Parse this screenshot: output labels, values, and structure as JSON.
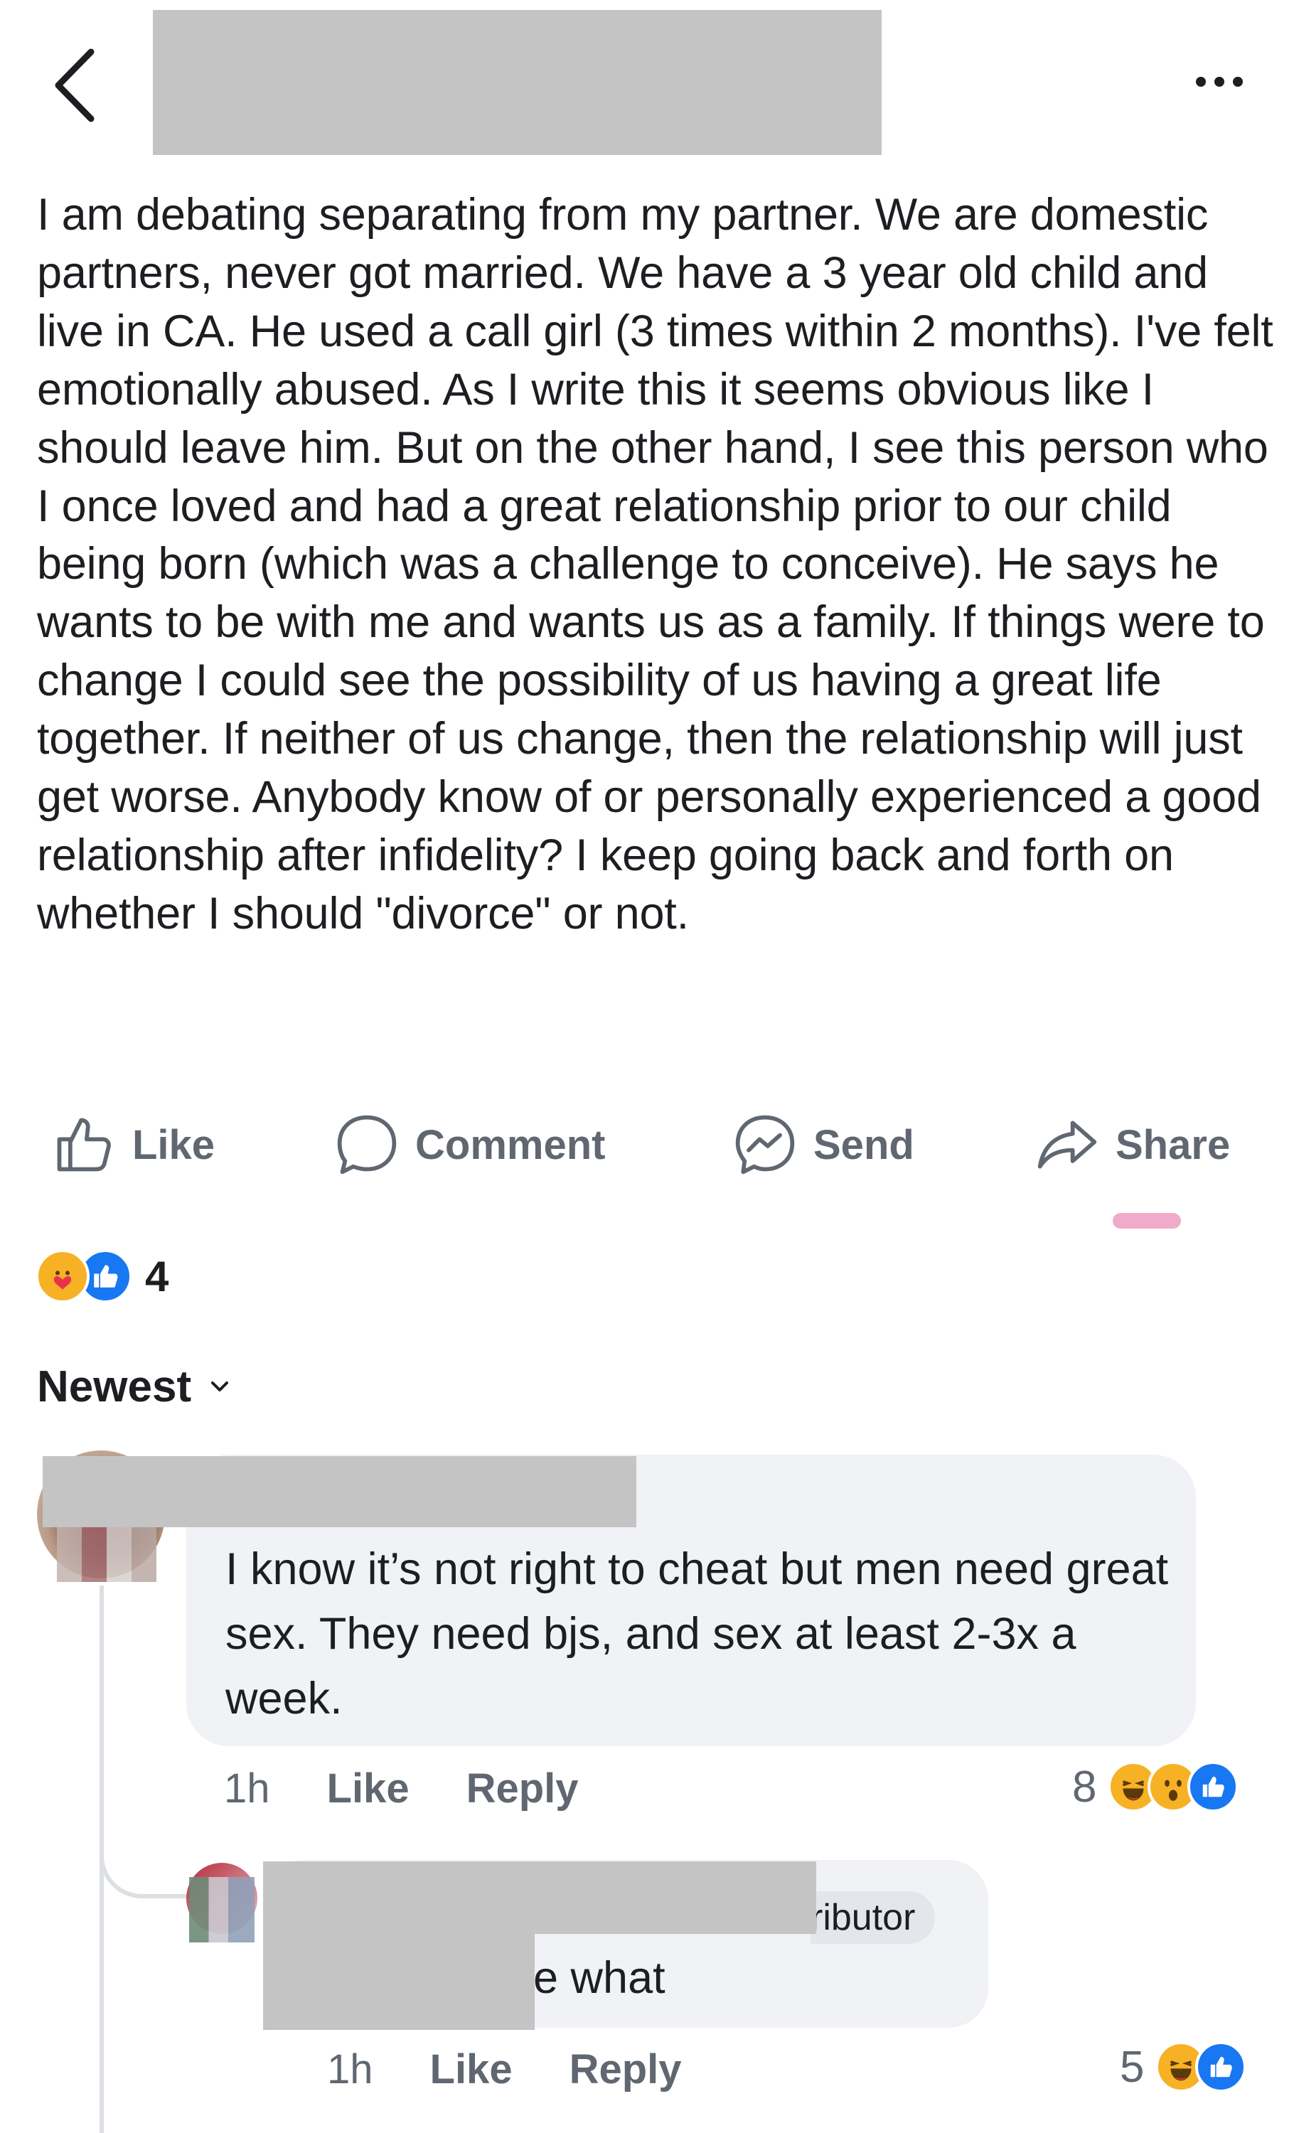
{
  "post": {
    "body": "I am debating separating from my partner. We are domestic partners, never got married. We have a 3 year old child and live in CA. He used a call girl (3 times within 2 months). I've felt emotionally abused. As I write this it seems obvious like I should leave him. But on the other hand, I see this person who I once loved and had a great relationship prior to our child being born (which was a challenge to conceive). He says he wants to be with me and wants us as a family. If things were to change I could see the possibility of us having a great life together. If neither of us change, then the relationship will just get worse. Anybody know of or personally experienced a good relationship after infidelity? I keep going back and forth on  whether I should \"divorce\" or not."
  },
  "actions": {
    "like": "Like",
    "comment": "Comment",
    "send": "Send",
    "share": "Share"
  },
  "reactions": {
    "count": "4",
    "icons": [
      "care-icon",
      "like-icon"
    ],
    "colors": {
      "like": "#1877f2",
      "care": "#f7b125"
    }
  },
  "sort": {
    "label": "Newest"
  },
  "comments": [
    {
      "text": "I know it’s not right to cheat but men need great sex. They need bjs, and sex at least 2-3x a week.",
      "time": "1h",
      "like": "Like",
      "reply": "Reply",
      "reaction_count": "8",
      "reaction_icons": [
        "haha-icon",
        "wow-icon",
        "like-icon"
      ]
    },
    {
      "badge_fragment": "ributor",
      "text_fragment": "e what",
      "time": "1h",
      "like": "Like",
      "reply": "Reply",
      "reaction_count": "5",
      "reaction_icons": [
        "haha-icon",
        "like-icon"
      ]
    }
  ]
}
